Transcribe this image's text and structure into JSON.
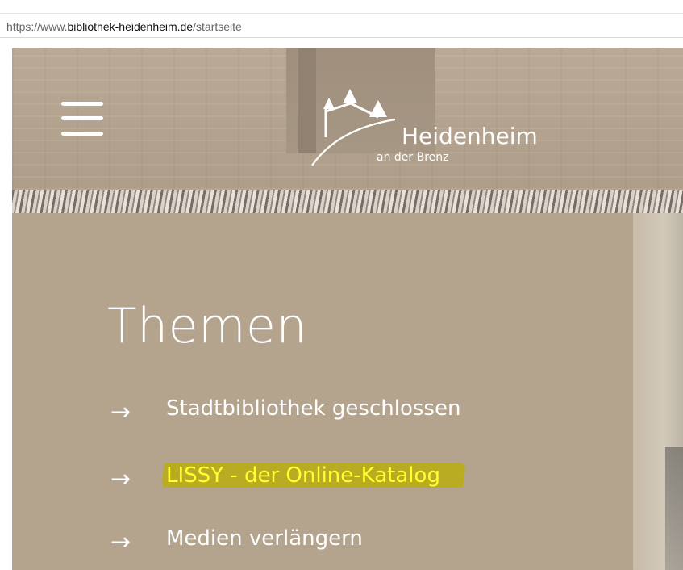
{
  "browser": {
    "url_prefix": "https://www.",
    "url_host": "bibliothek-heidenheim.de",
    "url_path": "/startseite"
  },
  "header": {
    "logo": {
      "name": "Heidenheim",
      "subtitle": "an der Brenz",
      "icon": "castle-logo-icon"
    },
    "menu_icon": "hamburger-menu-icon"
  },
  "main": {
    "heading": "Themen",
    "topics": [
      {
        "label": "Stadtbibliothek geschlossen",
        "icon": "arrow-right-icon",
        "highlighted": false
      },
      {
        "label": "LISSY - der Online-Katalog",
        "icon": "arrow-right-icon",
        "highlighted": true
      },
      {
        "label": "Medien verlängern",
        "icon": "arrow-right-icon",
        "highlighted": false
      }
    ]
  },
  "colors": {
    "panel": "#b4a48d",
    "header_wall": "#b3a28e",
    "highlight_marker": "#b9ac22",
    "highlight_text": "#ffff33",
    "text": "#ffffff"
  }
}
